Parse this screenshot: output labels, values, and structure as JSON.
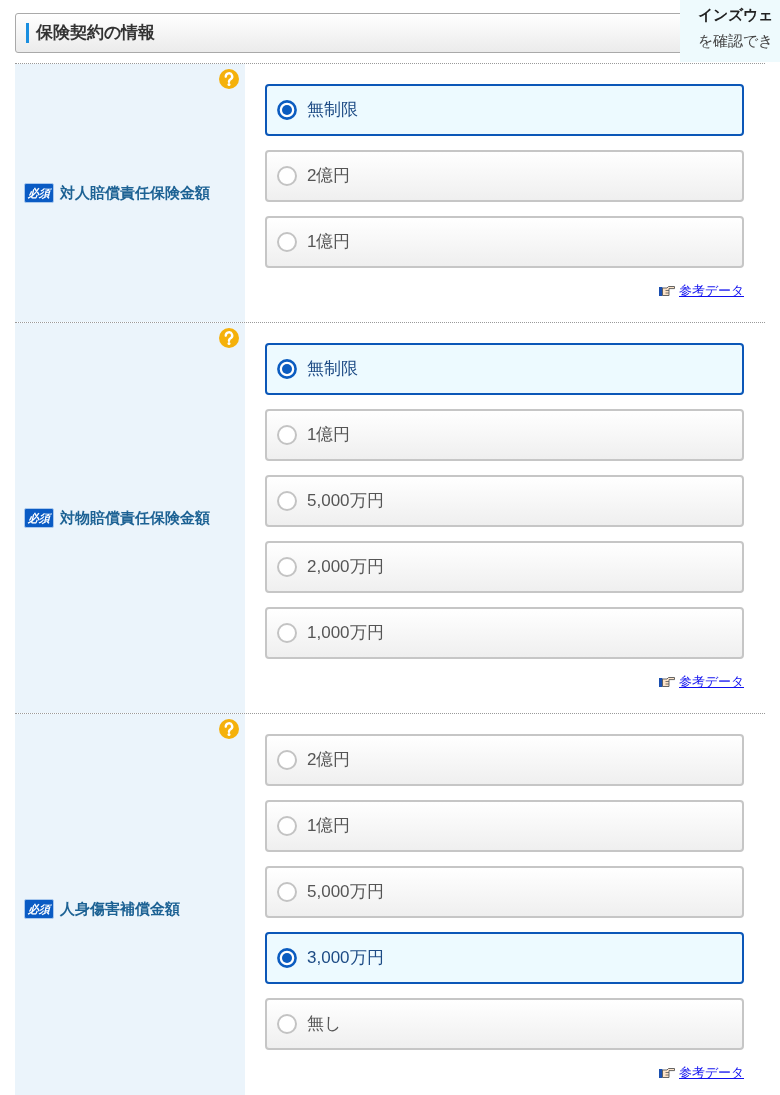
{
  "section_header": {
    "title": "保険契約の情報"
  },
  "tooltip": {
    "title": "インズウェ",
    "text": "を確認でき"
  },
  "fields": [
    {
      "badge": "必須",
      "label": "対人賠償責任保険金額",
      "options": [
        {
          "label": "無制限",
          "selected": true
        },
        {
          "label": "2億円",
          "selected": false
        },
        {
          "label": "1億円",
          "selected": false
        }
      ],
      "reference_link": "参考データ"
    },
    {
      "badge": "必須",
      "label": "対物賠償責任保険金額",
      "options": [
        {
          "label": "無制限",
          "selected": true
        },
        {
          "label": "1億円",
          "selected": false
        },
        {
          "label": "5,000万円",
          "selected": false
        },
        {
          "label": "2,000万円",
          "selected": false
        },
        {
          "label": "1,000万円",
          "selected": false
        }
      ],
      "reference_link": "参考データ"
    },
    {
      "badge": "必須",
      "label": "人身傷害補償金額",
      "options": [
        {
          "label": "2億円",
          "selected": false
        },
        {
          "label": "1億円",
          "selected": false
        },
        {
          "label": "5,000万円",
          "selected": false
        },
        {
          "label": "3,000万円",
          "selected": true
        },
        {
          "label": "無し",
          "selected": false
        }
      ],
      "reference_link": "参考データ"
    }
  ]
}
